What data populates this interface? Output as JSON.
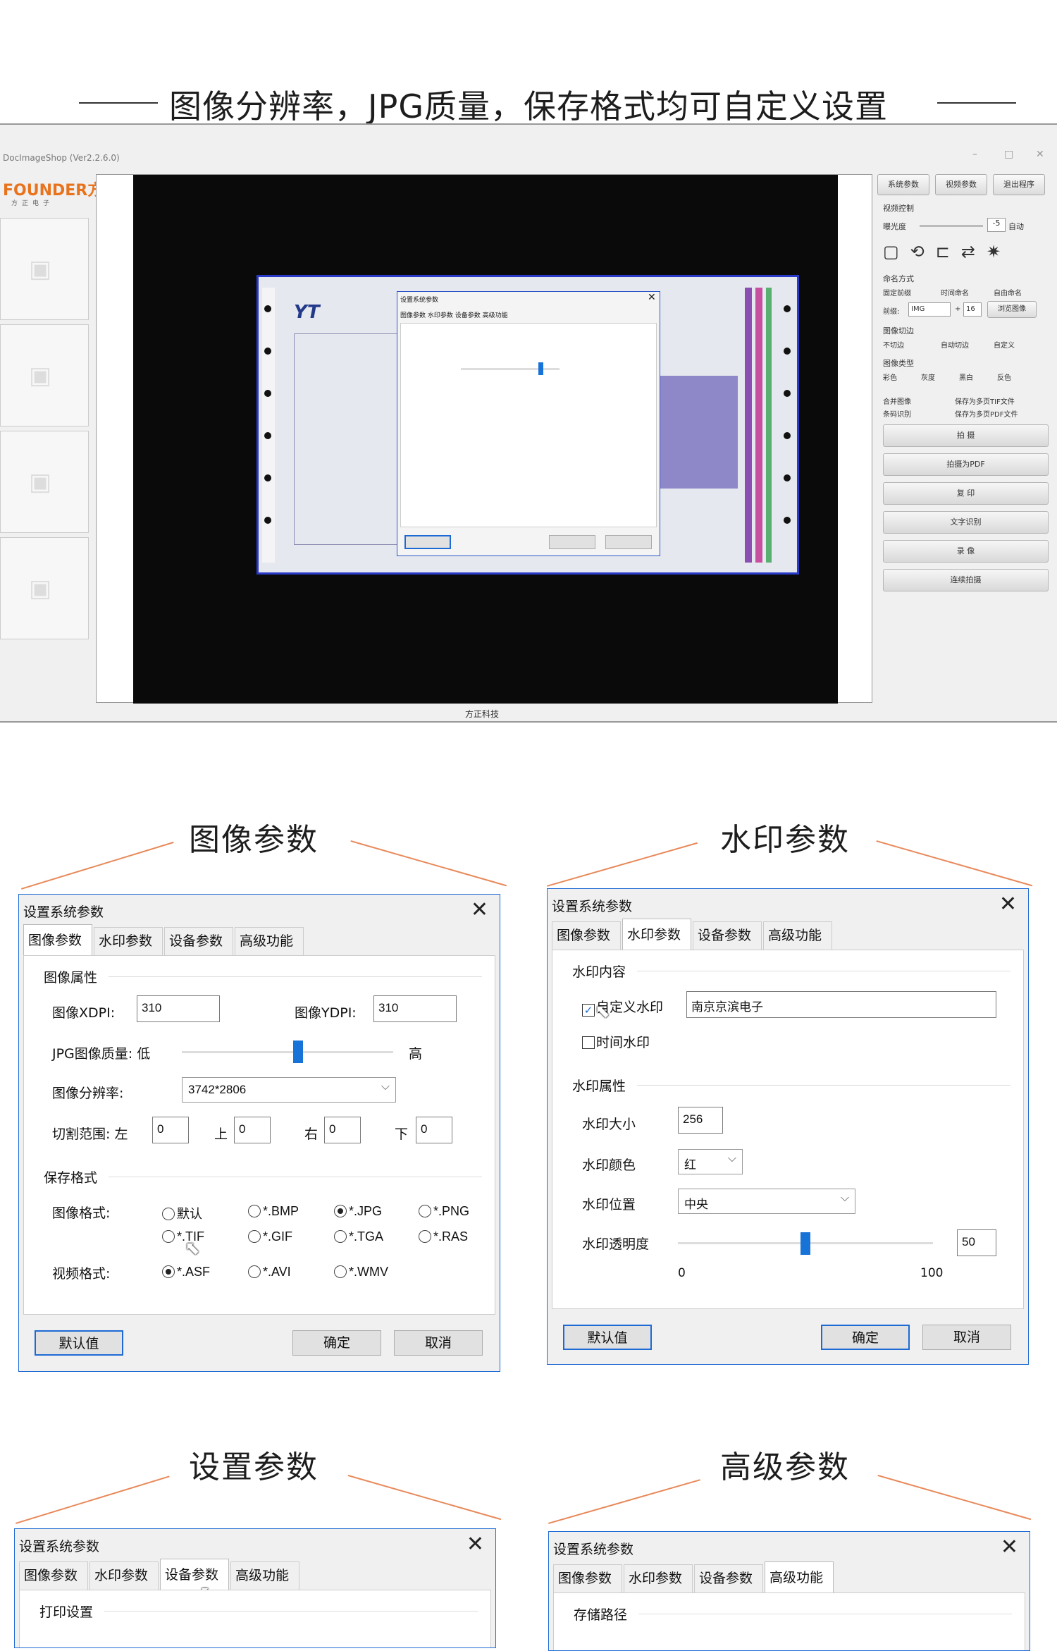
{
  "headline": "图像分辨率，JPG质量，保存格式均可自定义设置",
  "app": {
    "title": "DocImageShop (Ver2.2.6.0)",
    "logo": "FOUNDER方正",
    "logo_sub": "方正电子",
    "status": "方正科技",
    "buttons": [
      "系统参数",
      "视频参数",
      "退出程序"
    ],
    "video_ctrl": "视频控制",
    "brightness": "曝光度",
    "auto": "自动",
    "bright_val": "-5",
    "naming": "命名方式",
    "naming_opts": [
      "固定前缀",
      "时间命名",
      "自由命名"
    ],
    "prefix_lbl": "前缀:",
    "prefix": "IMG",
    "sep": "+",
    "num": "16",
    "browse": "浏览图像",
    "crop": "图像切边",
    "crop_opts": [
      "不切边",
      "自动切边",
      "自定义"
    ],
    "type": "图像类型",
    "type_opts": [
      "彩色",
      "灰度",
      "黑白",
      "反色"
    ],
    "merge": "合并图像",
    "multi_tif": "保存为多页TIF文件",
    "barcode": "条码识别",
    "multi_pdf": "保存为多页PDF文件",
    "actions": [
      "拍   摄",
      "拍摄为PDF",
      "复   印",
      "文字识别",
      "录   像",
      "连续拍摄"
    ]
  },
  "sections": {
    "image": "图像参数",
    "watermark": "水印参数",
    "settings": "设置参数",
    "advanced": "高级参数"
  },
  "dialog": {
    "title": "设置系统参数",
    "close": "✕",
    "tabs": [
      "图像参数",
      "水印参数",
      "设备参数",
      "高级功能"
    ],
    "default": "默认值",
    "ok": "确定",
    "cancel": "取消"
  },
  "image_dlg": {
    "group1": "图像属性",
    "xdpi_lbl": "图像XDPI:",
    "xdpi": "310",
    "ydpi_lbl": "图像YDPI:",
    "ydpi": "310",
    "jpg_lbl": "JPG图像质量: 低",
    "jpg_high": "高",
    "jpg_quality": 0.55,
    "res_lbl": "图像分辨率:",
    "res": "3742*2806",
    "crop_lbl": "切割范围: 左",
    "crop_top": "上",
    "crop_right": "右",
    "crop_bottom": "下",
    "crop_vals": [
      "0",
      "0",
      "0",
      "0"
    ],
    "group2": "保存格式",
    "fmt_lbl": "图像格式:",
    "fmt_opts": [
      "默认",
      "*.BMP",
      "*.JPG",
      "*.PNG",
      "*.TIF",
      "*.GIF",
      "*.TGA",
      "*.RAS"
    ],
    "vid_lbl": "视频格式:",
    "vid_opts": [
      "*.ASF",
      "*.AVI",
      "*.WMV"
    ]
  },
  "wm_dlg": {
    "group1": "水印内容",
    "custom": "自定义水印",
    "custom_val": "南京京滨电子",
    "time": "时间水印",
    "group2": "水印属性",
    "size_lbl": "水印大小",
    "size": "256",
    "color_lbl": "水印颜色",
    "color": "红",
    "pos_lbl": "水印位置",
    "pos": "中央",
    "alpha_lbl": "水印透明度",
    "alpha": "50",
    "min": "0",
    "max": "100",
    "alpha_frac": 0.5
  },
  "settings_dlg": {
    "group1": "打印设置"
  },
  "adv_dlg": {
    "group1": "存储路径"
  },
  "colors": {
    "accent": "#1e6ad4",
    "orange": "#e8895a"
  }
}
